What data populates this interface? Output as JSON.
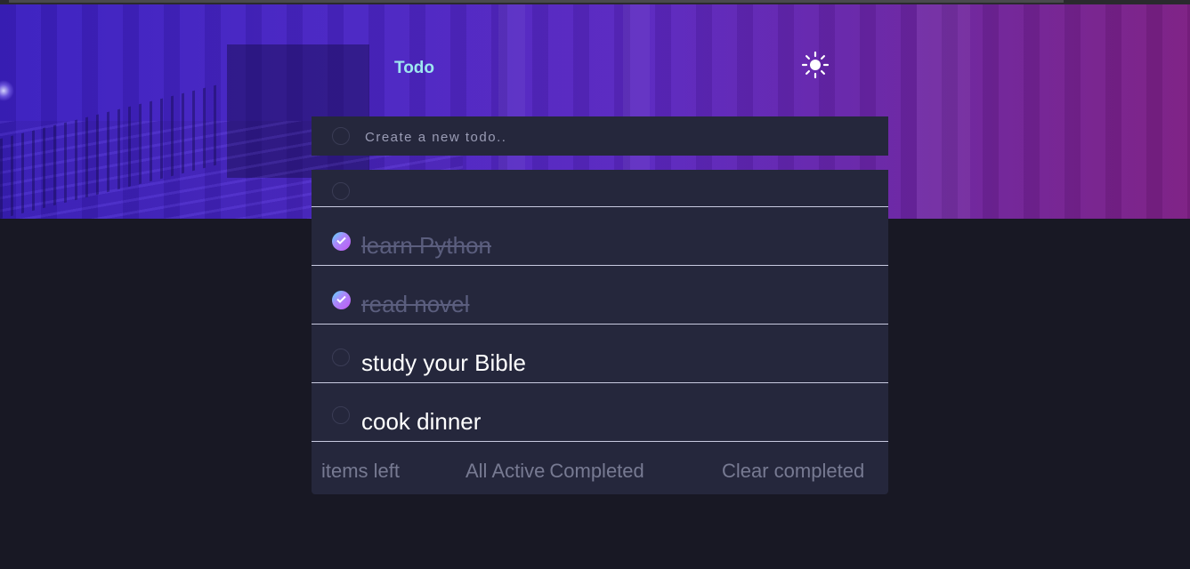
{
  "header": {
    "title": "Todo",
    "theme_icon": "sun-icon"
  },
  "new_todo": {
    "placeholder": "Create a new todo..",
    "value": ""
  },
  "todos": [
    {
      "text": "",
      "completed": false
    },
    {
      "text": "learn Python",
      "completed": true
    },
    {
      "text": "read novel",
      "completed": true
    },
    {
      "text": "study your Bible",
      "completed": false
    },
    {
      "text": "cook dinner",
      "completed": false
    }
  ],
  "footer": {
    "items_left": "items left",
    "filters": [
      "All",
      "Active",
      "Completed"
    ],
    "clear_label": "Clear completed"
  },
  "colors": {
    "accent_gradient_start": "#57ddff",
    "accent_gradient_end": "#c058f3",
    "card_background": "#25273c",
    "page_background": "#181824",
    "title_color": "#9ee6f0"
  }
}
